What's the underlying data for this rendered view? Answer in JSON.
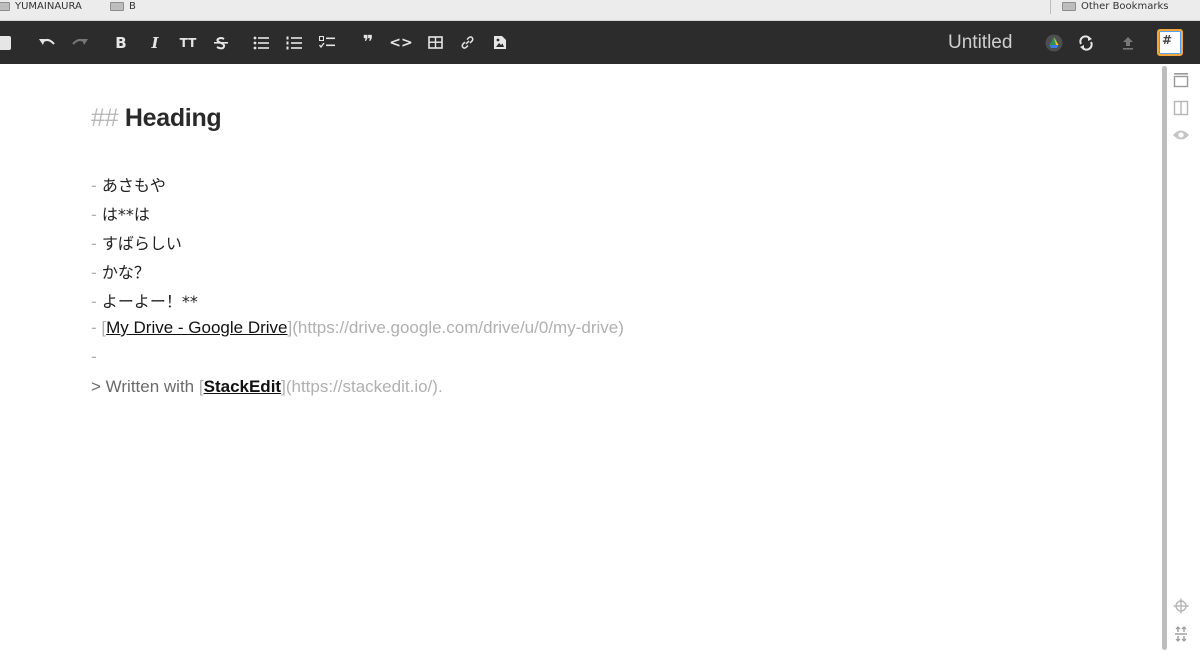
{
  "bookmarks": {
    "items": [
      {
        "label": "YUMAINAURA"
      },
      {
        "label": "B"
      }
    ],
    "other": "Other Bookmarks"
  },
  "toolbar": {
    "title": "Untitled",
    "badge": "#",
    "buttons": [
      "toggle-sidebar",
      "undo",
      "redo",
      "bold",
      "italic",
      "heading",
      "strikethrough",
      "unordered-list",
      "ordered-list",
      "check-list",
      "blockquote",
      "code",
      "table",
      "link",
      "image"
    ]
  },
  "editor": {
    "heading": {
      "marker": "##",
      "text": "Heading"
    },
    "list_marker": "-",
    "items": [
      "あさもや",
      "は**は",
      "すばらしい",
      "かな？",
      "よーよー！**"
    ],
    "link_item": {
      "open": "[",
      "text": "My Drive - Google Drive",
      "mid": "](",
      "url": "https://drive.google.com/drive/u/0/my-drive",
      "close": ")"
    },
    "empty_marker": "-",
    "quote": {
      "prefix": "> Written with ",
      "open": "[",
      "text": "StackEdit",
      "mid": "](",
      "url": "https://stackedit.io/",
      "close": ").",
      "close_tail": ""
    }
  },
  "right_panel": {
    "icons": [
      "editor-only-icon",
      "side-by-side-icon",
      "preview-icon",
      "scroll-sync-icon",
      "navigation-icon"
    ]
  }
}
